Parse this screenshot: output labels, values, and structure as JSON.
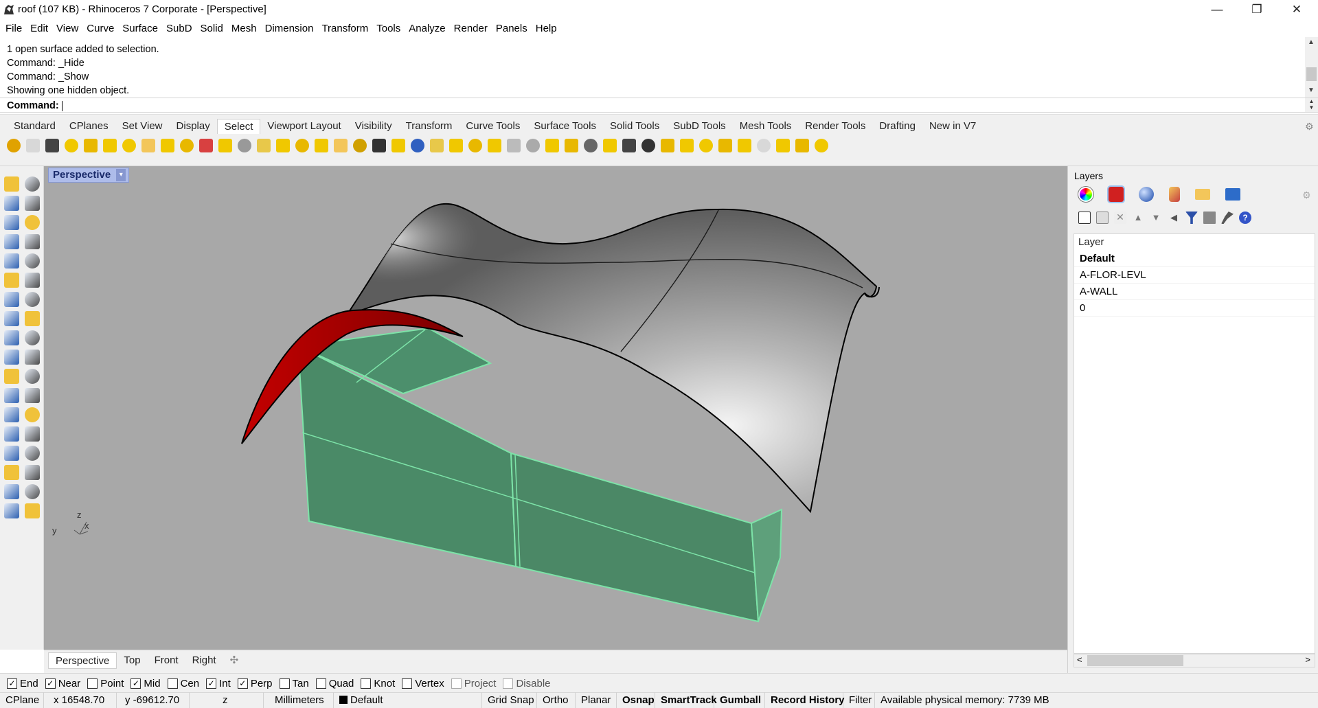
{
  "window": {
    "title": "roof (107 KB) - Rhinoceros 7 Corporate - [Perspective]",
    "minimize_icon": "minimize-icon",
    "maximize_icon": "restore-icon",
    "close_icon": "close-icon",
    "minimize_glyph": "—",
    "maximize_glyph": "❐",
    "close_glyph": "✕"
  },
  "menu": [
    "File",
    "Edit",
    "View",
    "Curve",
    "Surface",
    "SubD",
    "Solid",
    "Mesh",
    "Dimension",
    "Transform",
    "Tools",
    "Analyze",
    "Render",
    "Panels",
    "Help"
  ],
  "command": {
    "history": [
      "1 open surface added to selection.",
      "Command: _Hide",
      "Command: _Show",
      "Showing one hidden object."
    ],
    "prompt_label": "Command:",
    "value": ""
  },
  "toolbar_tabs": {
    "tabs": [
      "Standard",
      "CPlanes",
      "Set View",
      "Display",
      "Select",
      "Viewport Layout",
      "Visibility",
      "Transform",
      "Curve Tools",
      "Surface Tools",
      "Solid Tools",
      "SubD Tools",
      "Mesh Tools",
      "Render Tools",
      "Drafting",
      "New in V7"
    ],
    "active": "Select",
    "gear_glyph": "⚙"
  },
  "viewport": {
    "title": "Perspective",
    "dropdown_glyph": "▾",
    "axes": {
      "x": "x",
      "y": "y",
      "z": "z"
    }
  },
  "viewport_tabs": {
    "tabs": [
      "Perspective",
      "Top",
      "Front",
      "Right"
    ],
    "add_glyph": "✣"
  },
  "layers_panel": {
    "title": "Layers",
    "column_header": "Layer",
    "layers": [
      {
        "name": "Default",
        "current": true
      },
      {
        "name": "A-FLOR-LEVL",
        "current": false
      },
      {
        "name": "A-WALL",
        "current": false
      },
      {
        "name": "0",
        "current": false
      }
    ],
    "scroll_left": "<",
    "scroll_right": ">"
  },
  "osnap": [
    {
      "label": "End",
      "checked": true,
      "enabled": true
    },
    {
      "label": "Near",
      "checked": true,
      "enabled": true
    },
    {
      "label": "Point",
      "checked": false,
      "enabled": true
    },
    {
      "label": "Mid",
      "checked": true,
      "enabled": true
    },
    {
      "label": "Cen",
      "checked": false,
      "enabled": true
    },
    {
      "label": "Int",
      "checked": true,
      "enabled": true
    },
    {
      "label": "Perp",
      "checked": true,
      "enabled": true
    },
    {
      "label": "Tan",
      "checked": false,
      "enabled": true
    },
    {
      "label": "Quad",
      "checked": false,
      "enabled": true
    },
    {
      "label": "Knot",
      "checked": false,
      "enabled": true
    },
    {
      "label": "Vertex",
      "checked": false,
      "enabled": true
    },
    {
      "label": "Project",
      "checked": false,
      "enabled": false
    },
    {
      "label": "Disable",
      "checked": false,
      "enabled": false
    }
  ],
  "status": {
    "cplane": "CPlane",
    "x": "x 16548.70",
    "y": "y -69612.70",
    "z": "z",
    "units": "Millimeters",
    "layer": "Default",
    "grid_snap": "Grid Snap",
    "ortho": "Ortho",
    "planar": "Planar",
    "osnap": "Osnap",
    "smarttrack": "SmartTrack",
    "gumball": "Gumball",
    "record_history": "Record History",
    "filter": "Filter",
    "memory": "Available physical memory: 7739 MB"
  },
  "colors": {
    "viewport_bg": "#a8a8a8",
    "viewport_label": "#aebcea",
    "box_fill": "#4e8a68",
    "box_edge": "#7ee6a8",
    "red_surface": "#a50000",
    "roof_light": "#f2f2f2",
    "roof_dark": "#5a5a5a"
  }
}
